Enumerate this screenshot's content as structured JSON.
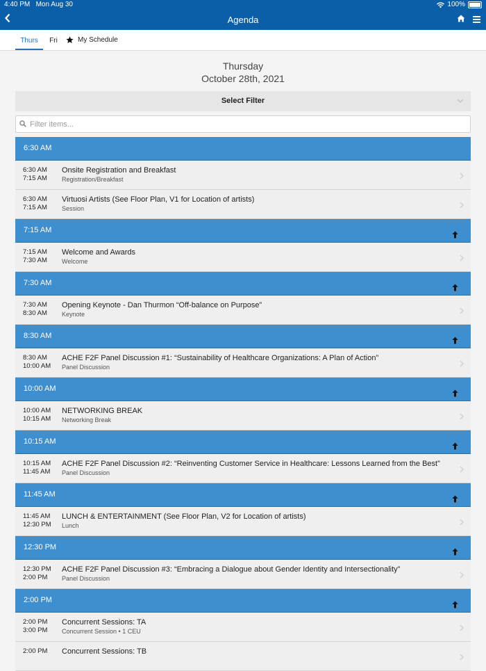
{
  "status_bar": {
    "time": "4:40 PM",
    "date": "Mon Aug 30",
    "battery": "100%"
  },
  "nav": {
    "title": "Agenda"
  },
  "tabs": [
    {
      "label": "Thurs",
      "active": true
    },
    {
      "label": "Fri",
      "active": false
    },
    {
      "label": "My Schedule",
      "active": false
    }
  ],
  "day": {
    "name": "Thursday",
    "date": "October 28th, 2021"
  },
  "filter": {
    "label": "Select Filter"
  },
  "search": {
    "placeholder": "Filter items..."
  },
  "colors": {
    "header_blue": "#0b5fa8",
    "slot_blue": "#3e8fcf",
    "tab_active": "#1f74bf"
  },
  "slots": [
    {
      "label": "6:30 AM",
      "collapse_icon": false,
      "sessions": [
        {
          "start": "6:30 AM",
          "end": "7:15 AM",
          "title": "Onsite Registration and Breakfast",
          "type": "Registration/Breakfast"
        },
        {
          "start": "6:30 AM",
          "end": "7:15 AM",
          "title": "Virtuosi Artists (See Floor Plan, V1 for Location of artists)",
          "type": "Session"
        }
      ]
    },
    {
      "label": "7:15 AM",
      "collapse_icon": true,
      "sessions": [
        {
          "start": "7:15 AM",
          "end": "7:30 AM",
          "title": "Welcome and Awards",
          "type": "Welcome"
        }
      ]
    },
    {
      "label": "7:30 AM",
      "collapse_icon": true,
      "sessions": [
        {
          "start": "7:30 AM",
          "end": "8:30 AM",
          "title": "Opening Keynote - Dan Thurmon “Off-balance on Purpose”",
          "type": "Keynote"
        }
      ]
    },
    {
      "label": "8:30 AM",
      "collapse_icon": true,
      "sessions": [
        {
          "start": "8:30 AM",
          "end": "10:00 AM",
          "title": "ACHE F2F Panel Discussion #1: “Sustainability of Healthcare Organizations:  A Plan of Action”",
          "type": "Panel Discussion"
        }
      ]
    },
    {
      "label": "10:00 AM",
      "collapse_icon": true,
      "sessions": [
        {
          "start": "10:00 AM",
          "end": "10:15 AM",
          "title": "NETWORKING BREAK",
          "type": "Networking Break"
        }
      ]
    },
    {
      "label": "10:15 AM",
      "collapse_icon": true,
      "sessions": [
        {
          "start": "10:15 AM",
          "end": "11:45 AM",
          "title": "ACHE F2F Panel Discussion #2: “Reinventing Customer Service in Healthcare: Lessons Learned from the Best”",
          "type": "Panel Discussion"
        }
      ]
    },
    {
      "label": "11:45 AM",
      "collapse_icon": true,
      "sessions": [
        {
          "start": "11:45 AM",
          "end": "12:30 PM",
          "title": "LUNCH & ENTERTAINMENT (See Floor Plan, V2 for Location of artists)",
          "type": "Lunch"
        }
      ]
    },
    {
      "label": "12:30 PM",
      "collapse_icon": true,
      "sessions": [
        {
          "start": "12:30 PM",
          "end": "2:00 PM",
          "title": "ACHE F2F Panel Discussion #3: “Embracing a Dialogue about Gender Identity and Intersectionality”",
          "type": "Panel Discussion"
        }
      ]
    },
    {
      "label": "2:00 PM",
      "collapse_icon": true,
      "sessions": [
        {
          "start": "2:00 PM",
          "end": "3:00 PM",
          "title": "Concurrent Sessions: TA",
          "type": "Concurrent Session • 1 CEU"
        },
        {
          "start": "2:00 PM",
          "end": "",
          "title": "Concurrent Sessions: TB",
          "type": ""
        }
      ]
    }
  ]
}
